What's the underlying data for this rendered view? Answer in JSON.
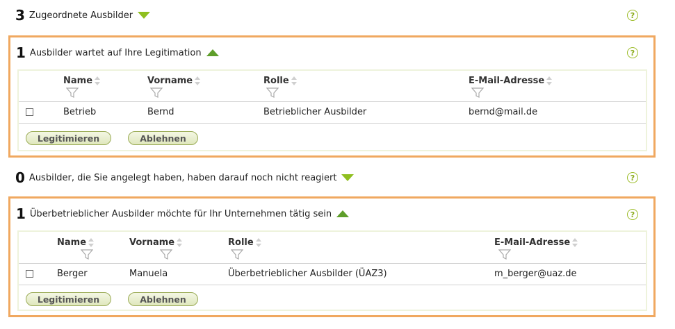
{
  "sections": [
    {
      "count": "3",
      "text": "Zugeordnete Ausbilder"
    },
    {
      "count": "1",
      "text": "Ausbilder wartet auf Ihre Legitimation"
    },
    {
      "count": "0",
      "text": "Ausbilder, die Sie angelegt haben, haben darauf noch nicht reagiert"
    },
    {
      "count": "1",
      "text": "Überbetrieblicher Ausbilder möchte für Ihr Unternehmen tätig sein"
    }
  ],
  "help_label": "?",
  "columns": {
    "name": "Name",
    "vorname": "Vorname",
    "rolle": "Rolle",
    "email": "E-Mail-Adresse"
  },
  "table1": {
    "rows": [
      {
        "name": "Betrieb",
        "vorname": "Bernd",
        "rolle": "Betrieblicher Ausbilder",
        "email": "bernd@mail.de"
      }
    ]
  },
  "table2": {
    "rows": [
      {
        "name": "Berger",
        "vorname": "Manuela",
        "rolle": "Überbetrieblicher Ausbilder (ÜAZ3)",
        "email": "m_berger@uaz.de"
      }
    ]
  },
  "buttons": {
    "legitimieren": "Legitimieren",
    "ablehnen": "Ablehnen"
  },
  "colors": {
    "panel_border": "#f0a860",
    "accent_green": "#8fbf1f",
    "inner_border": "#eef3dc"
  }
}
